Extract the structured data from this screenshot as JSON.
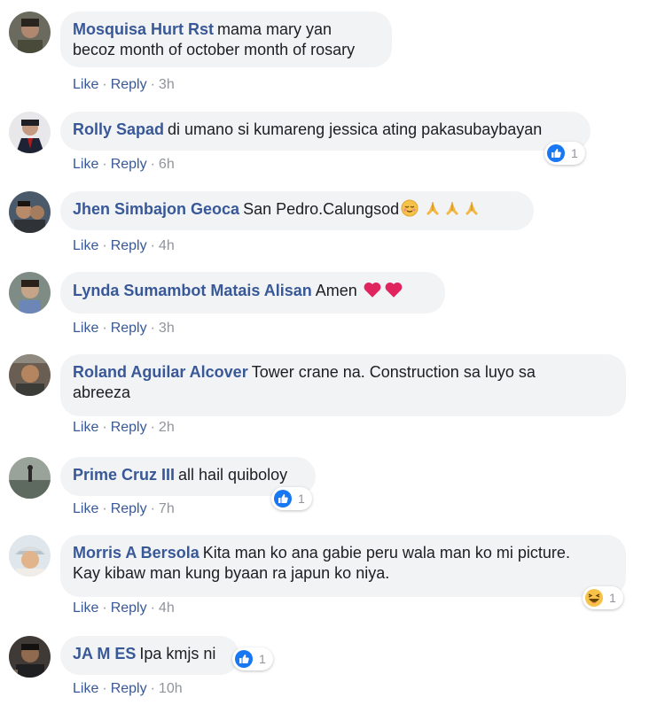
{
  "ui": {
    "like": "Like",
    "reply": "Reply",
    "sep": "·"
  },
  "comments": [
    {
      "author": "Mosquisa Hurt Rst",
      "text_lines": [
        "mama mary yan",
        "becoz month of october month of rosary"
      ],
      "time": "3h"
    },
    {
      "author": "Rolly Sapad",
      "text": "di umano si kumareng jessica ating pakasubaybayan",
      "time": "6h",
      "reaction": {
        "icon": "like-reaction-icon",
        "count": "1"
      }
    },
    {
      "author": "Jhen Simbajon Geoca",
      "text": "San Pedro.Calungsod",
      "emojis": [
        "relieved-face-icon",
        "folded-hands-icon",
        "folded-hands-icon",
        "folded-hands-icon"
      ],
      "time": "4h"
    },
    {
      "author": "Lynda Sumambot Matais Alisan",
      "text": "Amen",
      "emojis": [
        "red-heart-icon",
        "red-heart-icon"
      ],
      "time": "3h"
    },
    {
      "author": "Roland Aguilar Alcover",
      "text_lines": [
        "Tower crane na. Construction sa luyo sa",
        "abreeza"
      ],
      "time": "2h"
    },
    {
      "author": "Prime Cruz III",
      "text": "all hail quiboloy",
      "time": "7h",
      "reaction": {
        "icon": "like-reaction-icon",
        "count": "1"
      }
    },
    {
      "author": "Morris A Bersola",
      "text_lines": [
        "Kita man ko ana gabie peru wala man ko mi picture.",
        "Kay kibaw man kung byaan ra japun ko niya."
      ],
      "time": "4h",
      "reaction": {
        "icon": "haha-reaction-icon",
        "count": "1"
      }
    },
    {
      "author": "JA M ES",
      "text": "Ipa kmjs ni",
      "time": "10h",
      "reaction": {
        "icon": "like-reaction-icon",
        "count": "1"
      }
    }
  ],
  "colors": {
    "author": "#385898",
    "bubble": "#f2f3f5",
    "meta": "#90949c",
    "like_blue": "#1877f2",
    "heart": "#e0245e"
  }
}
